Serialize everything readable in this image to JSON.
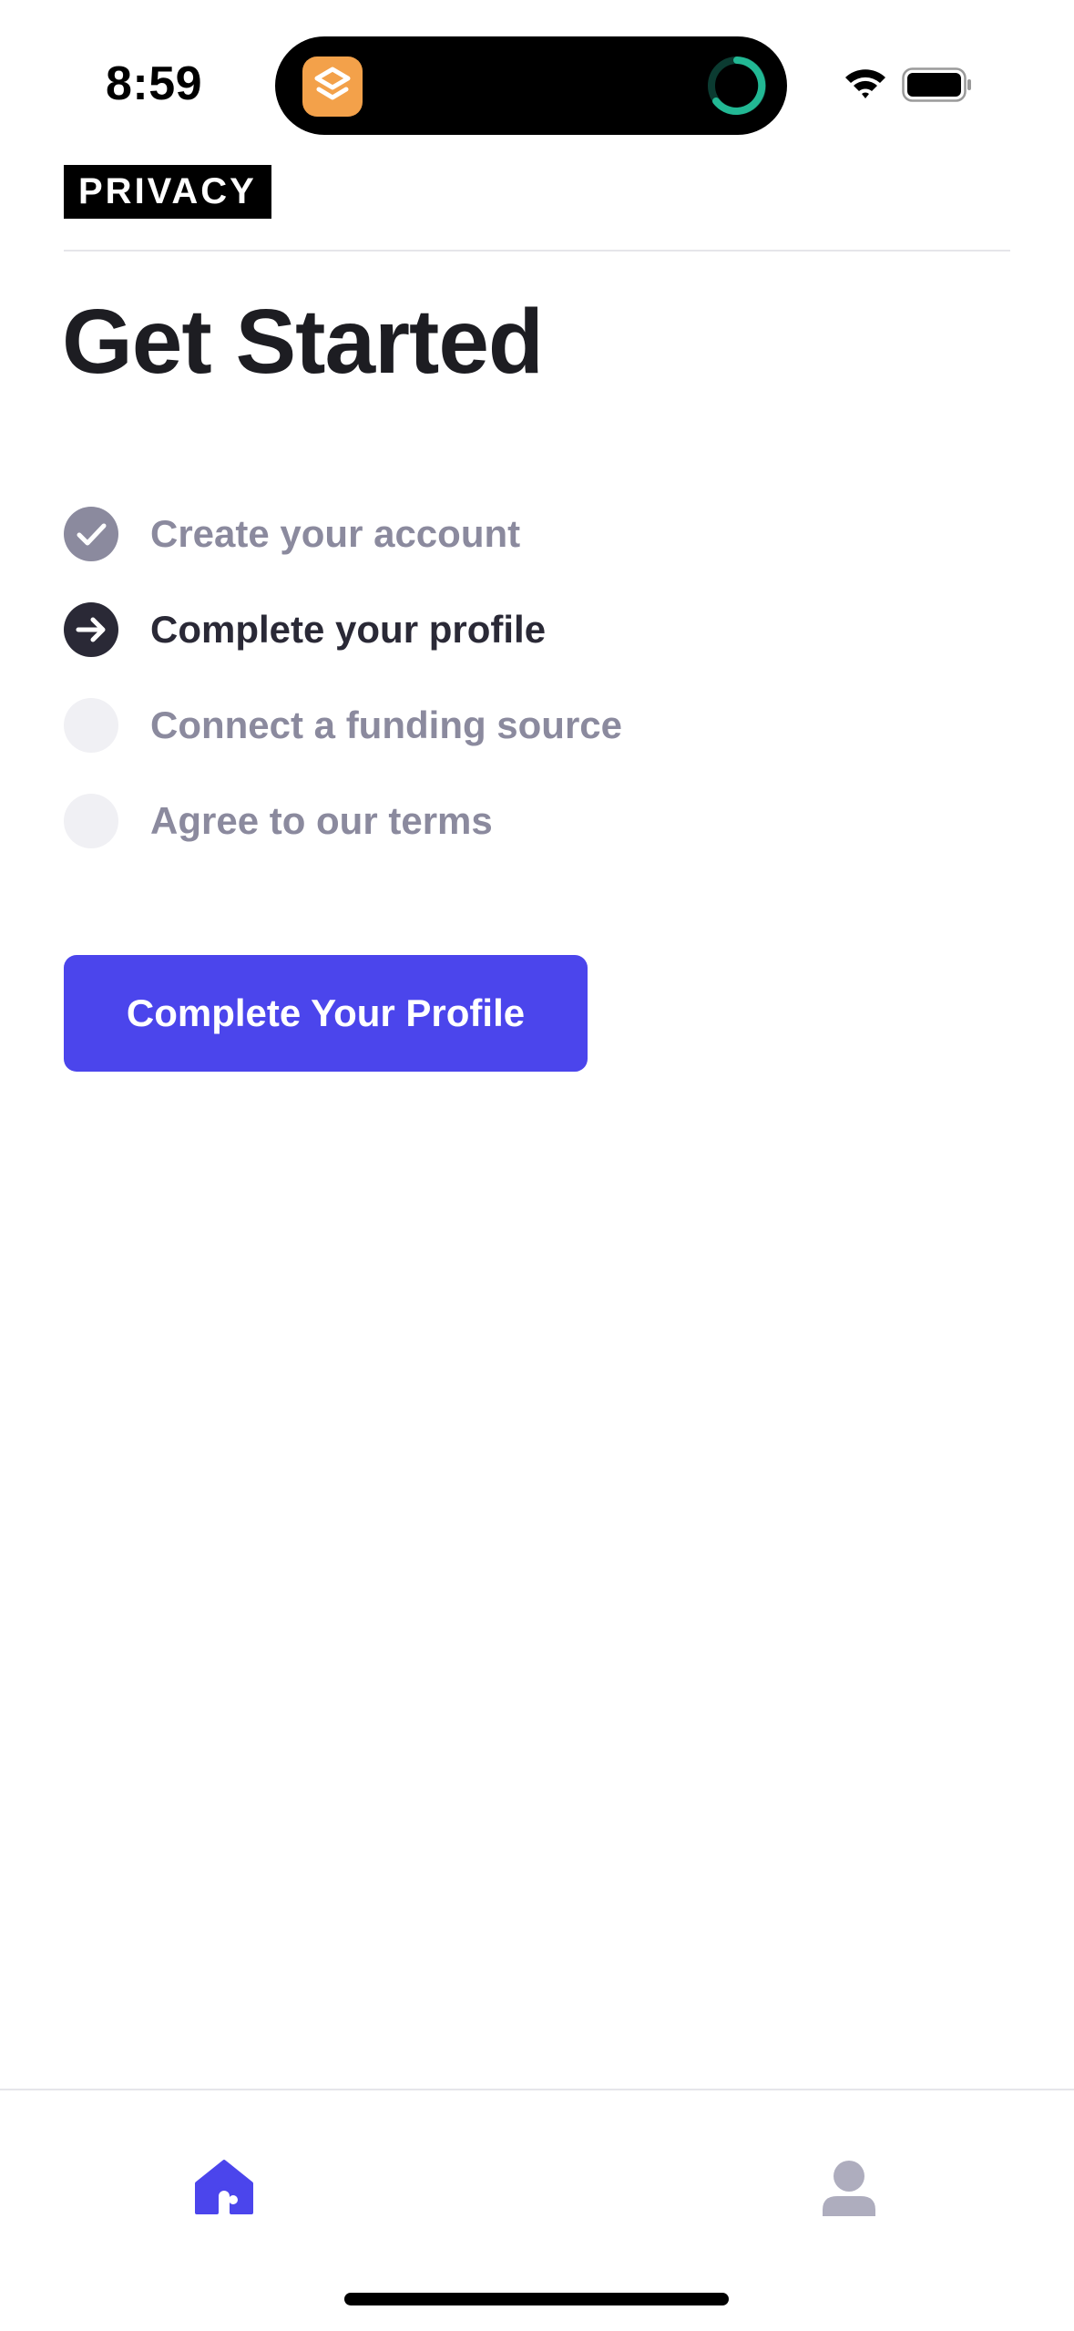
{
  "status_bar": {
    "time": "8:59"
  },
  "header": {
    "brand": "PRIVACY"
  },
  "page": {
    "title": "Get Started"
  },
  "steps": [
    {
      "label": "Create your account",
      "state": "done",
      "icon": "checkmark-icon"
    },
    {
      "label": "Complete your profile",
      "state": "current",
      "icon": "arrow-right-icon"
    },
    {
      "label": "Connect a funding source",
      "state": "todo",
      "icon": "empty-circle"
    },
    {
      "label": "Agree to our terms",
      "state": "todo",
      "icon": "empty-circle"
    }
  ],
  "cta": {
    "label": "Complete Your Profile"
  },
  "tab_bar": {
    "tabs": [
      {
        "name": "home",
        "icon": "home-icon",
        "active": true
      },
      {
        "name": "profile",
        "icon": "person-icon",
        "active": false
      }
    ]
  },
  "colors": {
    "accent": "#4b45ec",
    "inactive_tab": "#aeadbe",
    "step_done": "#8b8a9e",
    "step_current": "#2a2936",
    "step_todo": "#f0f0f4",
    "island_app": "#f3a14a",
    "island_progress": "#22b894"
  }
}
